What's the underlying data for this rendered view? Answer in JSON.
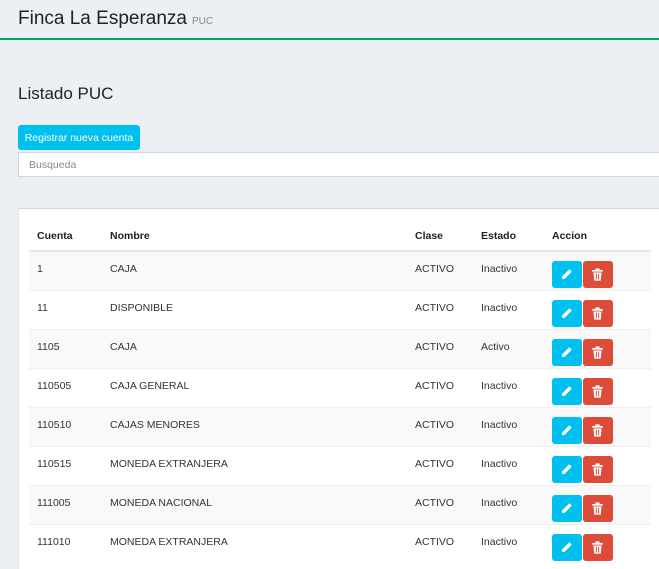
{
  "header": {
    "title": "Finca La Esperanza",
    "subtitle": "PUC"
  },
  "page": {
    "title": "Listado PUC"
  },
  "toolbar": {
    "register_label": "Registrar nueva cuenta"
  },
  "search": {
    "placeholder": "Busqueda",
    "value": ""
  },
  "table": {
    "columns": [
      "Cuenta",
      "Nombre",
      "Clase",
      "Estado",
      "Accion"
    ],
    "rows": [
      [
        "1",
        "CAJA",
        "ACTIVO",
        "Inactivo"
      ],
      [
        "11",
        "DISPONIBLE",
        "ACTIVO",
        "Inactivo"
      ],
      [
        "1105",
        "CAJA",
        "ACTIVO",
        "Activo"
      ],
      [
        "110505",
        "CAJA GENERAL",
        "ACTIVO",
        "Inactivo"
      ],
      [
        "110510",
        "CAJAS MENORES",
        "ACTIVO",
        "Inactivo"
      ],
      [
        "110515",
        "MONEDA EXTRANJERA",
        "ACTIVO",
        "Inactivo"
      ],
      [
        "111005",
        "MONEDA NACIONAL",
        "ACTIVO",
        "Inactivo"
      ],
      [
        "111010",
        "MONEDA EXTRANJERA",
        "ACTIVO",
        "Inactivo"
      ]
    ],
    "row_actions": {
      "edit_icon": "pencil-icon",
      "delete_icon": "trash-icon"
    }
  },
  "colors": {
    "primary": "#00c0ef",
    "danger": "#dd4b39",
    "header_accent": "#00a65a",
    "page_background": "#ecf0f5"
  }
}
